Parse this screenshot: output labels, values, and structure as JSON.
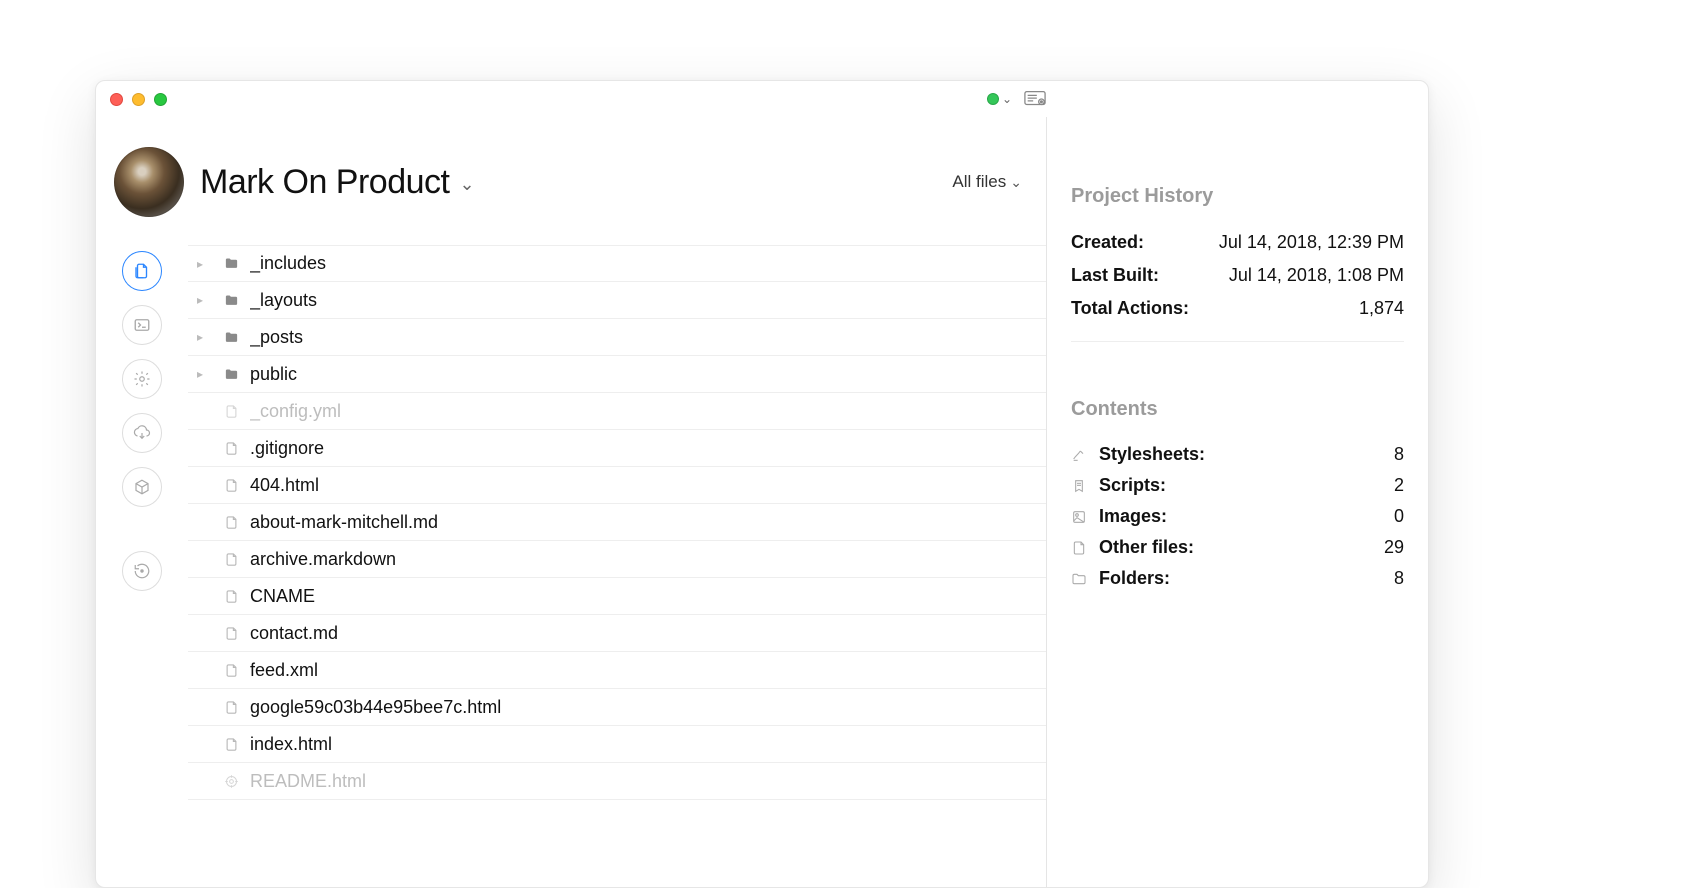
{
  "project": {
    "name": "Mark On Product"
  },
  "toolbar": {
    "filter_label": "All files"
  },
  "files": [
    {
      "name": "_includes",
      "type": "folder",
      "expandable": true,
      "dim": false
    },
    {
      "name": "_layouts",
      "type": "folder",
      "expandable": true,
      "dim": false
    },
    {
      "name": "_posts",
      "type": "folder",
      "expandable": true,
      "dim": false
    },
    {
      "name": "public",
      "type": "folder",
      "expandable": true,
      "dim": false
    },
    {
      "name": "_config.yml",
      "type": "file",
      "expandable": false,
      "dim": true
    },
    {
      "name": ".gitignore",
      "type": "file",
      "expandable": false,
      "dim": false
    },
    {
      "name": "404.html",
      "type": "file",
      "expandable": false,
      "dim": false
    },
    {
      "name": "about-mark-mitchell.md",
      "type": "file",
      "expandable": false,
      "dim": false
    },
    {
      "name": "archive.markdown",
      "type": "file",
      "expandable": false,
      "dim": false
    },
    {
      "name": "CNAME",
      "type": "file",
      "expandable": false,
      "dim": false
    },
    {
      "name": "contact.md",
      "type": "file",
      "expandable": false,
      "dim": false
    },
    {
      "name": "feed.xml",
      "type": "file",
      "expandable": false,
      "dim": false
    },
    {
      "name": "google59c03b44e95bee7c.html",
      "type": "file",
      "expandable": false,
      "dim": false
    },
    {
      "name": "index.html",
      "type": "file",
      "expandable": false,
      "dim": false
    },
    {
      "name": "README.html",
      "type": "file",
      "expandable": false,
      "dim": true
    }
  ],
  "sidebar": {
    "history_title": "Project History",
    "contents_title": "Contents",
    "created_label": "Created:",
    "created_value": "Jul 14, 2018, 12:39 PM",
    "built_label": "Last Built:",
    "built_value": "Jul 14, 2018, 1:08 PM",
    "actions_label": "Total Actions:",
    "actions_value": "1,874",
    "contents": [
      {
        "label": "Stylesheets:",
        "value": "8"
      },
      {
        "label": "Scripts:",
        "value": "2"
      },
      {
        "label": "Images:",
        "value": "0"
      },
      {
        "label": "Other files:",
        "value": "29"
      },
      {
        "label": "Folders:",
        "value": "8"
      }
    ]
  }
}
